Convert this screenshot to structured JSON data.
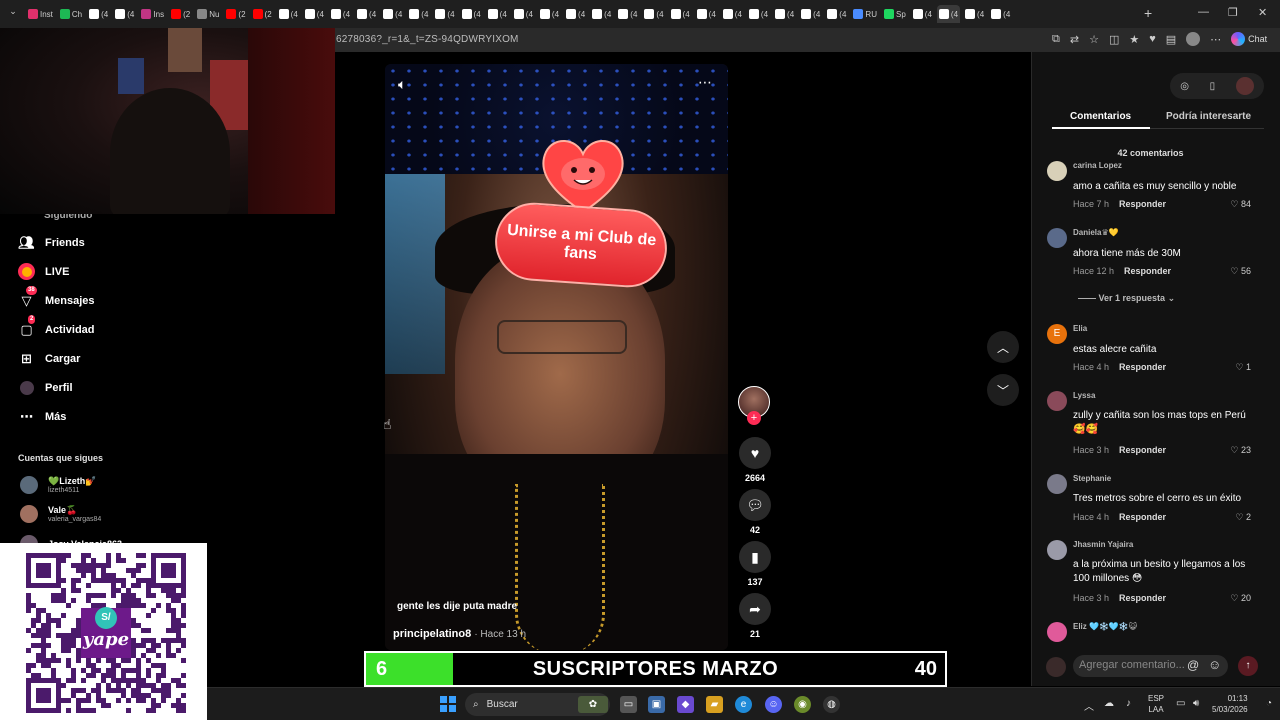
{
  "browser": {
    "tabs": [
      {
        "label": "Inst",
        "color": "#e1306c"
      },
      {
        "label": "Ch",
        "color": "#1db954"
      },
      {
        "label": "(4",
        "color": "#ffffff"
      },
      {
        "label": "(4",
        "color": "#ffffff"
      },
      {
        "label": "Ins",
        "color": "#c13584"
      },
      {
        "label": "(2",
        "color": "#ff0000"
      },
      {
        "label": "Nu",
        "color": "#888888"
      },
      {
        "label": "(2",
        "color": "#ff0000"
      },
      {
        "label": "(2",
        "color": "#ff0000"
      },
      {
        "label": "(4",
        "color": "#ffffff"
      },
      {
        "label": "(4",
        "color": "#ffffff"
      },
      {
        "label": "(4",
        "color": "#ffffff"
      },
      {
        "label": "(4",
        "color": "#ffffff"
      },
      {
        "label": "(4",
        "color": "#ffffff"
      },
      {
        "label": "(4",
        "color": "#ffffff"
      },
      {
        "label": "(4",
        "color": "#ffffff"
      },
      {
        "label": "(4",
        "color": "#ffffff"
      },
      {
        "label": "(4",
        "color": "#ffffff"
      },
      {
        "label": "(4",
        "color": "#ffffff"
      },
      {
        "label": "(4",
        "color": "#ffffff"
      },
      {
        "label": "(4",
        "color": "#ffffff"
      },
      {
        "label": "(4",
        "color": "#ffffff"
      },
      {
        "label": "(4",
        "color": "#ffffff"
      },
      {
        "label": "(4",
        "color": "#ffffff"
      },
      {
        "label": "(4",
        "color": "#ffffff"
      },
      {
        "label": "(4",
        "color": "#ffffff"
      },
      {
        "label": "(4",
        "color": "#ffffff"
      },
      {
        "label": "(4",
        "color": "#ffffff"
      },
      {
        "label": "(4",
        "color": "#ffffff"
      },
      {
        "label": "(4",
        "color": "#ffffff"
      },
      {
        "label": "(4",
        "color": "#ffffff"
      },
      {
        "label": "RU",
        "color": "#4a8cff"
      },
      {
        "label": "Sp",
        "color": "#1ed760"
      },
      {
        "label": "(4",
        "color": "#ffffff"
      },
      {
        "label": "(4",
        "color": "#ffffff"
      },
      {
        "label": "(4",
        "color": "#ffffff"
      },
      {
        "label": "(4",
        "color": "#ffffff"
      }
    ],
    "url": "6278036?_r=1&_t=ZS-94QDWRYIXOM",
    "chat_label": "Chat"
  },
  "sidebar": {
    "partial_item": "Siguiendo",
    "items": [
      {
        "label": "Friends",
        "icon": "friends-icon",
        "badge": ""
      },
      {
        "label": "LIVE",
        "icon": "live-icon",
        "badge": ""
      },
      {
        "label": "Mensajes",
        "icon": "messages-icon",
        "badge": "38"
      },
      {
        "label": "Actividad",
        "icon": "activity-icon",
        "badge": "2"
      },
      {
        "label": "Cargar",
        "icon": "upload-icon",
        "badge": ""
      },
      {
        "label": "Perfil",
        "icon": "profile-icon",
        "badge": ""
      },
      {
        "label": "Más",
        "icon": "more-icon",
        "badge": ""
      }
    ],
    "following_title": "Cuentas que sigues",
    "following": [
      {
        "name": "💚Lizeth💅",
        "handle": "lizeth4511",
        "color": "#5a6a7a"
      },
      {
        "name": "Vale🍒",
        "handle": "valeria_vargas84",
        "color": "#a07060"
      },
      {
        "name": "Josy Valencia863",
        "handle": "",
        "color": "#6a5a6a"
      }
    ]
  },
  "video": {
    "sticker_text": "Unirse a mi Club de fans",
    "caption": "gente les dije puta madre",
    "author": "principelatino8",
    "time": "· Hace 13 h",
    "likes": "2664",
    "comments": "42",
    "saves": "137",
    "shares": "21"
  },
  "comments_panel": {
    "tab_comments": "Comentarios",
    "tab_interest": "Podría interesarte",
    "count": "42 comentarios",
    "reply_label": "Responder",
    "view_replies": "Ver 1 respuesta",
    "input_placeholder": "Agregar comentario...",
    "items": [
      {
        "user": "carina Lopez",
        "text": "amo a cañita es muy sencillo y noble",
        "time": "Hace 7 h",
        "likes": "84",
        "color": "#d8d0b8"
      },
      {
        "user": "Daniela♛💛",
        "text": "ahora tiene más de 30M",
        "time": "Hace 12 h",
        "likes": "56",
        "color": "#5a6a8a"
      },
      {
        "user": "Elia",
        "text": "estas alecre cañita",
        "time": "Hace 4 h",
        "likes": "1",
        "color": "#e8720c"
      },
      {
        "user": "Lyssa",
        "text": "zully y cañita son los mas tops en Perú 🥰🥰",
        "time": "Hace 3 h",
        "likes": "23",
        "color": "#8a4a5a"
      },
      {
        "user": "Stephanie",
        "text": "Tres metros sobre el cerro es un éxito",
        "time": "Hace 4 h",
        "likes": "2",
        "color": "#7a7a8a"
      },
      {
        "user": "Jhasmin Yajaira",
        "text": "a la próxima un besito y llegamos a los 100 millones 😳",
        "time": "Hace 3 h",
        "likes": "20",
        "color": "#9a9aa8"
      },
      {
        "user": "Eliz 🩵❄️🩵❄️😺",
        "text": "",
        "time": "",
        "likes": "",
        "color": "#e05a9a"
      }
    ]
  },
  "subs": {
    "label": "SUSCRIPTORES MARZO",
    "current": "6",
    "goal": "40",
    "progress": 0.15,
    "fill_color": "#3ce02a"
  },
  "taskbar": {
    "search": "Buscar",
    "lang_top": "ESP",
    "lang_bottom": "LAA",
    "time": "01:13",
    "date": "5/03/2026"
  }
}
